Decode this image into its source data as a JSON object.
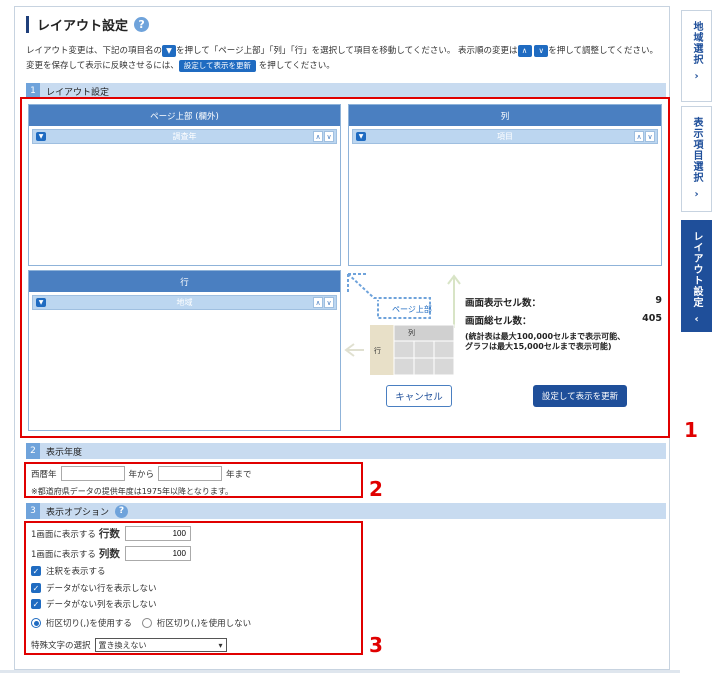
{
  "header": {
    "title": "レイアウト設定",
    "help": "?"
  },
  "intro": {
    "line1_a": "レイアウト変更は、下記の項目名の",
    "line1_b": "を押して「ページ上部」「列」「行」を選択して項目を移動してください。 表示順の変更は",
    "line1_c": "を押して調整してください。",
    "line2_a": "変更を保存して表示に反映させるには、",
    "line2_btn": "設定して表示を更新",
    "line2_b": "を押してください。"
  },
  "sections": {
    "layout": {
      "num": "1",
      "label": "レイアウト設定"
    },
    "year": {
      "num": "2",
      "label": "表示年度"
    },
    "options": {
      "num": "3",
      "label": "表示オプション"
    }
  },
  "boxes": {
    "page_top": {
      "header": "ページ上部 (欄外)",
      "item": "調査年"
    },
    "columns": {
      "header": "列",
      "item": "項目"
    },
    "rows": {
      "header": "行",
      "item": "地域"
    }
  },
  "diagram": {
    "page_label": "ページ上部",
    "col_label": "列",
    "row_label": "行"
  },
  "counts": {
    "display_label": "画面表示セル数：",
    "display_value": "9",
    "total_label": "画面総セル数：",
    "total_value": "405",
    "note1": "(統計表は最大100,000セルまで表示可能、",
    "note2": "グラフは最大15,000セルまで表示可能)"
  },
  "buttons": {
    "cancel": "キャンセル",
    "update": "設定して表示を更新"
  },
  "year": {
    "prefix": "西暦年",
    "from_label": "年から",
    "to_label": "年まで",
    "from_value": "",
    "to_value": "",
    "note": "※都道府県データの提供年度は1975年以降となります。"
  },
  "options": {
    "rows_prefix": "1画面に表示する",
    "rows_label": "行数",
    "rows_value": "100",
    "cols_prefix": "1画面に表示する",
    "cols_label": "列数",
    "cols_value": "100",
    "chk1": "注釈を表示する",
    "chk2": "データがない行を表示しない",
    "chk3": "データがない列を表示しない",
    "radio1": "桁区切り(,)を使用する",
    "radio2": "桁区切り(,)を使用しない",
    "special_label": "特殊文字の選択",
    "special_value": "置き換えない"
  },
  "annotations": {
    "n1": "1",
    "n2": "2",
    "n3": "3"
  },
  "sidetabs": [
    {
      "label": "地域選択"
    },
    {
      "label": "表示項目選択"
    },
    {
      "label": "レイアウト設定"
    }
  ],
  "icons": {
    "toggle": "triangle-down-icon",
    "up": "chevron-up-icon",
    "down": "chevron-down-icon",
    "chevron_right": "chevron-right-icon",
    "chevron_left": "chevron-left-icon"
  },
  "colors": {
    "accent": "#1f6bc1",
    "dark_accent": "#1f4f9a",
    "header_blue": "#4a7fc1",
    "section_bg": "#c8dbf0",
    "annotation_red": "#e00000"
  }
}
